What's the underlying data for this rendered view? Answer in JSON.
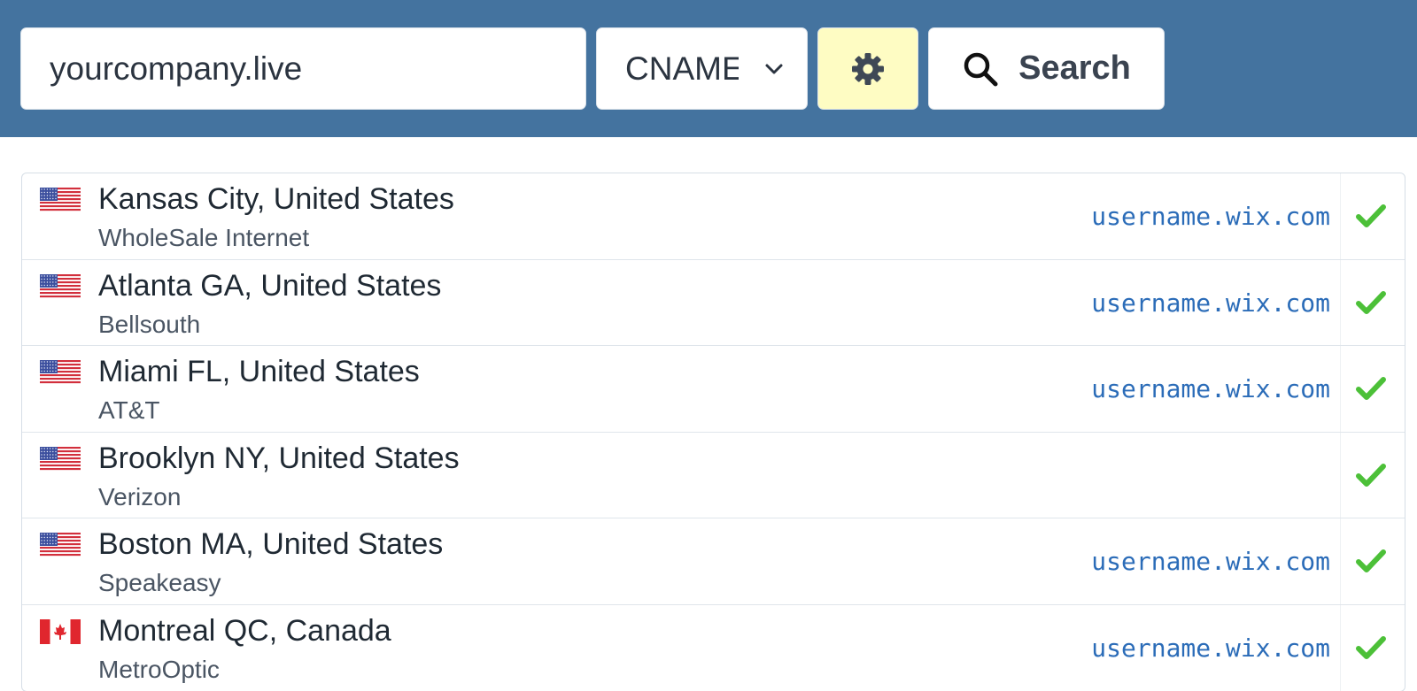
{
  "search": {
    "domain_value": "yourcompany.live",
    "record_type": "CNAME",
    "search_label": "Search"
  },
  "icons": {
    "dropdown": "chevron-down-icon",
    "settings": "gear-icon",
    "search": "search-icon",
    "status": "check-icon"
  },
  "colors": {
    "header_bg": "#44739f",
    "settings_bg": "#fefcc3",
    "value_text": "#2b6cb8",
    "check": "#4cc038"
  },
  "results": [
    {
      "flag": "us",
      "location": "Kansas City, United States",
      "isp": "WholeSale Internet",
      "value": "username.wix.com",
      "status": "ok"
    },
    {
      "flag": "us",
      "location": "Atlanta GA, United States",
      "isp": "Bellsouth",
      "value": "username.wix.com",
      "status": "ok"
    },
    {
      "flag": "us",
      "location": "Miami FL, United States",
      "isp": "AT&T",
      "value": "username.wix.com",
      "status": "ok"
    },
    {
      "flag": "us",
      "location": "Brooklyn NY, United States",
      "isp": "Verizon",
      "value": "",
      "status": "ok"
    },
    {
      "flag": "us",
      "location": "Boston MA, United States",
      "isp": "Speakeasy",
      "value": "username.wix.com",
      "status": "ok"
    },
    {
      "flag": "ca",
      "location": "Montreal QC, Canada",
      "isp": "MetroOptic",
      "value": "username.wix.com",
      "status": "ok"
    }
  ]
}
